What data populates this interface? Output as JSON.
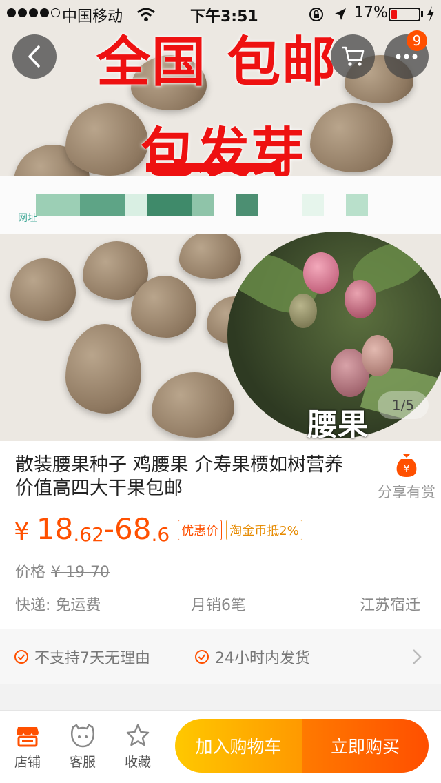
{
  "status_bar": {
    "carrier": "中国移动",
    "time": "下午3:51",
    "battery_percent": "17%",
    "battery_level": 0.17
  },
  "hero": {
    "promo_line1": "全国  包邮",
    "promo_line2": "包发芽",
    "photo_label": "腰果",
    "image_counter": "1/5",
    "overlay_small_text": "网址"
  },
  "header": {
    "cart_badge_count": "9"
  },
  "product": {
    "title": "散装腰果种子  鸡腰果 介寿果槚如树营养价值高四大干果包邮",
    "price_symbol": "¥",
    "price_low_int": "18",
    "price_low_dec": ".62",
    "price_sep": "-",
    "price_high_int": "68",
    "price_high_dec": ".6",
    "discount_tag": "优惠价",
    "coin_tag": "淘金币抵2%",
    "orig_label": "价格",
    "orig_price": "¥ 19-70",
    "shipping": "快递: 免运费",
    "monthly_sales": "月销6笔",
    "location": "江苏宿迁"
  },
  "share": {
    "label": "分享有赏",
    "icon_text": "¥"
  },
  "guarantees": [
    {
      "text": "不支持7天无理由"
    },
    {
      "text": "24小时内发货"
    }
  ],
  "bottom_bar": {
    "shop": "店铺",
    "service": "客服",
    "favorite": "收藏",
    "add_to_cart": "加入购物车",
    "buy_now": "立即购买"
  },
  "colors": {
    "accent": "#ff5000",
    "cart_gradient": [
      "#ffc800",
      "#ff9900"
    ],
    "buy_gradient": [
      "#ff7a00",
      "#ff4f00"
    ]
  }
}
